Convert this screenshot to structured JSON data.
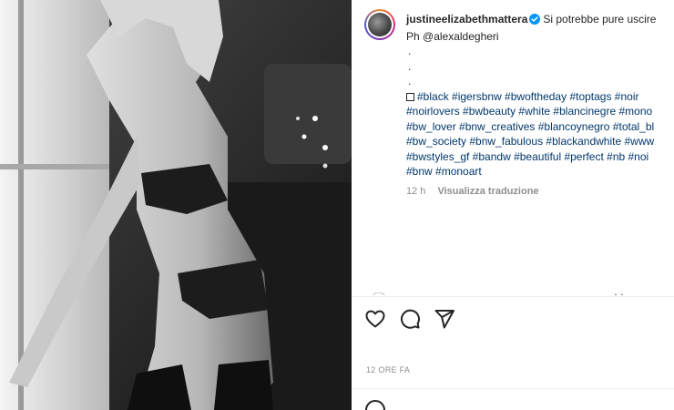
{
  "post": {
    "photo_alt": "black and white photo",
    "username": "justineelizabethmattera",
    "caption_text": "Si potrebbe pure uscire",
    "credit_line": "Ph @alexaldegheri",
    "dots": [
      ".",
      ".",
      "."
    ],
    "hashtag_lines": [
      "#black #igersbnw #bwoftheday #toptags #noir",
      "#noirlovers #bwbeauty #white #blancinegre #mono",
      "#bw_lover #bnw_creatives #blancoynegro #total_bl",
      "#bw_society #bnw_fabulous #blackandwhite #www",
      "#bwstyles_gf #bandw #beautiful #perfect #nb #noi",
      "#bnw #monoart"
    ],
    "time_ago": "12 h",
    "translate_label": "Visualizza traduzione",
    "date_label": "12 ORE FA"
  },
  "icons": {
    "verified": "verified-badge-icon",
    "like": "heart-icon",
    "comment": "comment-icon",
    "share": "send-icon",
    "emoji": "emoji-icon"
  },
  "colors": {
    "hashtag": "#00376b",
    "verified": "#0095f6",
    "muted": "#8e8e8e",
    "text": "#262626"
  }
}
